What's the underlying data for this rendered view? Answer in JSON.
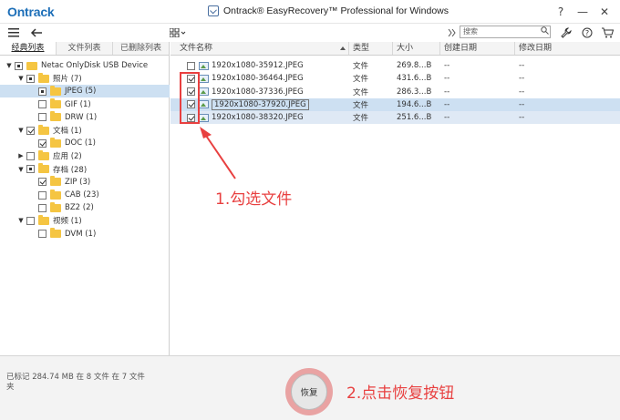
{
  "titlebar": {
    "logo": "Ontrack",
    "title": "Ontrack® EasyRecovery™ Professional for Windows",
    "help": "?",
    "minimize": "—",
    "close": "✕"
  },
  "toolbar": {
    "search_placeholder": "搜索"
  },
  "tabs": [
    {
      "label": "经典列表",
      "active": true
    },
    {
      "label": "文件列表",
      "active": false
    },
    {
      "label": "已删除列表",
      "active": false
    }
  ],
  "tree": [
    {
      "label": "Netac OnlyDisk USB Device",
      "exp": "▼",
      "cb": "partial",
      "icon": "drive",
      "indent": 0
    },
    {
      "label": "照片 (7)",
      "exp": "▼",
      "cb": "partial",
      "icon": "folder",
      "indent": 1
    },
    {
      "label": "JPEG (5)",
      "exp": "",
      "cb": "partial",
      "icon": "folder",
      "indent": 2,
      "selected": true
    },
    {
      "label": "GIF (1)",
      "exp": "",
      "cb": "none",
      "icon": "folder",
      "indent": 2
    },
    {
      "label": "DRW (1)",
      "exp": "",
      "cb": "none",
      "icon": "folder",
      "indent": 2
    },
    {
      "label": "文档 (1)",
      "exp": "▼",
      "cb": "checked",
      "icon": "folder",
      "indent": 1
    },
    {
      "label": "DOC (1)",
      "exp": "",
      "cb": "checked",
      "icon": "folder",
      "indent": 2
    },
    {
      "label": "应用 (2)",
      "exp": "▶",
      "cb": "none",
      "icon": "folder",
      "indent": 1
    },
    {
      "label": "存档 (28)",
      "exp": "▼",
      "cb": "partial",
      "icon": "folder",
      "indent": 1
    },
    {
      "label": "ZIP (3)",
      "exp": "",
      "cb": "checked",
      "icon": "folder",
      "indent": 2
    },
    {
      "label": "CAB (23)",
      "exp": "",
      "cb": "none",
      "icon": "folder",
      "indent": 2
    },
    {
      "label": "BZ2 (2)",
      "exp": "",
      "cb": "none",
      "icon": "folder",
      "indent": 2
    },
    {
      "label": "视频 (1)",
      "exp": "▼",
      "cb": "none",
      "icon": "folder",
      "indent": 1
    },
    {
      "label": "DVM (1)",
      "exp": "",
      "cb": "none",
      "icon": "folder",
      "indent": 2
    }
  ],
  "columns": [
    "文件名称",
    "类型",
    "大小",
    "创建日期",
    "修改日期"
  ],
  "files": [
    {
      "name": "1920x1080-35912.JPEG",
      "type": "文件",
      "size": "269.8...B",
      "created": "--",
      "modified": "--",
      "checked": false
    },
    {
      "name": "1920x1080-36464.JPEG",
      "type": "文件",
      "size": "431.6...B",
      "created": "--",
      "modified": "--",
      "checked": true
    },
    {
      "name": "1920x1080-37336.JPEG",
      "type": "文件",
      "size": "286.3...B",
      "created": "--",
      "modified": "--",
      "checked": true
    },
    {
      "name": "1920x1080-37920.JPEG",
      "type": "文件",
      "size": "194.6...B",
      "created": "--",
      "modified": "--",
      "checked": true,
      "highlight": "hl"
    },
    {
      "name": "1920x1080-38320.JPEG",
      "type": "文件",
      "size": "251.6...B",
      "created": "--",
      "modified": "--",
      "checked": true,
      "highlight": "hl2"
    }
  ],
  "status": "已标记 284.74 MB 在 8 文件 在 7 文件夹",
  "recover_label": "恢复",
  "annotations": {
    "step1": "1.勾选文件",
    "step2": "2.点击恢复按钮"
  },
  "colors": {
    "accent": "#1d6fb8",
    "annotation": "#e84040",
    "selection": "#cde0f2"
  }
}
